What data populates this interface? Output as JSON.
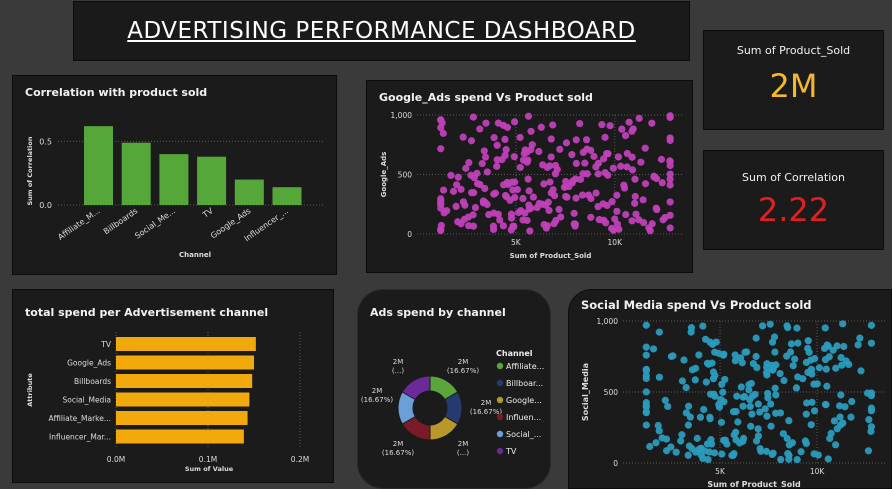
{
  "header": {
    "title": "ADVERTISING PERFORMANCE DASHBOARD"
  },
  "colors": {
    "green": "#56a73a",
    "magenta": "#c040b8",
    "orange": "#f2a90c",
    "teal": "#2a9bbd",
    "value_yellow": "#f3b82c",
    "value_red": "#e02020"
  },
  "cards": {
    "product_sold": {
      "label": "Sum of Product_Sold",
      "value": "2M"
    },
    "correlation": {
      "label": "Sum of Correlation",
      "value": "2.22"
    }
  },
  "corr_chart": {
    "title": "Correlation with product sold"
  },
  "google_chart": {
    "title": "Google_Ads spend Vs Product sold"
  },
  "spend_chart": {
    "title": "total spend per Advertisement channel"
  },
  "donut_chart": {
    "title": "Ads spend by channel"
  },
  "social_chart": {
    "title": "Social Media spend Vs Product sold"
  },
  "chart_data": [
    {
      "type": "bar",
      "title": "Correlation with product sold",
      "categories": [
        "Affiliate_M...",
        "Billboards",
        "Social_Me...",
        "TV",
        "Google_Ads",
        "Influencer_..."
      ],
      "values": [
        0.62,
        0.49,
        0.4,
        0.38,
        0.2,
        0.14
      ],
      "xlabel": "Channel",
      "ylabel": "Sum of Correlation",
      "yticks": [
        "0.0",
        "0.5"
      ],
      "ylim": [
        0,
        0.7
      ],
      "color": "#56a73a"
    },
    {
      "type": "scatter",
      "title": "Google_Ads spend Vs Product sold",
      "xlabel": "Sum of Product_Sold",
      "ylabel": "Google_Ads",
      "xticks": [
        "5K",
        "10K"
      ],
      "yticks": [
        "0",
        "500",
        "1,000"
      ],
      "xlim": [
        0,
        13500
      ],
      "ylim": [
        0,
        1000
      ],
      "color": "#c040b8"
    },
    {
      "type": "bar",
      "orientation": "horizontal",
      "title": "total spend per Advertisement channel",
      "categories": [
        "TV",
        "Google_Ads",
        "Billboards",
        "Social_Media",
        "Affiliate_Marke...",
        "Influencer_Mar..."
      ],
      "values": [
        0.152,
        0.15,
        0.148,
        0.145,
        0.143,
        0.139
      ],
      "xlabel": "Sum of Value",
      "ylabel": "Attribute",
      "xticks": [
        "0.0M",
        "0.1M",
        "0.2M"
      ],
      "xlim": [
        0,
        0.2
      ],
      "color": "#f2a90c"
    },
    {
      "type": "pie",
      "title": "Ads spend by channel",
      "legend_title": "Channel",
      "labels": [
        "Affiliate...",
        "Billboar...",
        "Google...",
        "Influen...",
        "Social_...",
        "TV"
      ],
      "values": [
        16.67,
        16.67,
        16.67,
        16.67,
        16.67,
        16.67
      ],
      "colors": [
        "#5aa63c",
        "#253a6e",
        "#b8982a",
        "#7a1c28",
        "#6b9fd8",
        "#6a2a9a"
      ],
      "slice_labels": [
        {
          "value": "2M",
          "pct": "(16.67%)"
        },
        {
          "value": "2M",
          "pct": "(16.67%)"
        },
        {
          "value": "2M",
          "pct": "(...)"
        },
        {
          "value": "2M",
          "pct": "(16.67%)"
        },
        {
          "value": "2M",
          "pct": "(16.67%)"
        },
        {
          "value": "2M",
          "pct": "(...)"
        }
      ]
    },
    {
      "type": "scatter",
      "title": "Social Media spend Vs Product sold",
      "xlabel": "Sum of Product_Sold",
      "ylabel": "Social_Media",
      "xticks": [
        "5K",
        "10K"
      ],
      "yticks": [
        "0",
        "500",
        "1,000"
      ],
      "xlim": [
        0,
        13500
      ],
      "ylim": [
        0,
        1000
      ],
      "color": "#2a9bbd"
    }
  ]
}
